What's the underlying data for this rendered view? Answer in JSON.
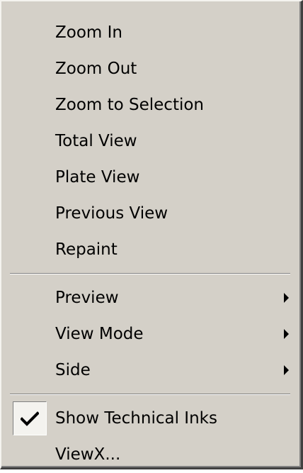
{
  "menu": {
    "items": [
      {
        "label": "Zoom In"
      },
      {
        "label": "Zoom Out"
      },
      {
        "label": "Zoom to Selection"
      },
      {
        "label": "Total View"
      },
      {
        "label": "Plate View"
      },
      {
        "label": "Previous View"
      },
      {
        "label": "Repaint"
      },
      {
        "label": "Preview",
        "submenu": true
      },
      {
        "label": "View Mode",
        "submenu": true
      },
      {
        "label": "Side",
        "submenu": true
      },
      {
        "label": "Show Technical Inks",
        "checked": true
      },
      {
        "label": "ViewX..."
      }
    ]
  }
}
